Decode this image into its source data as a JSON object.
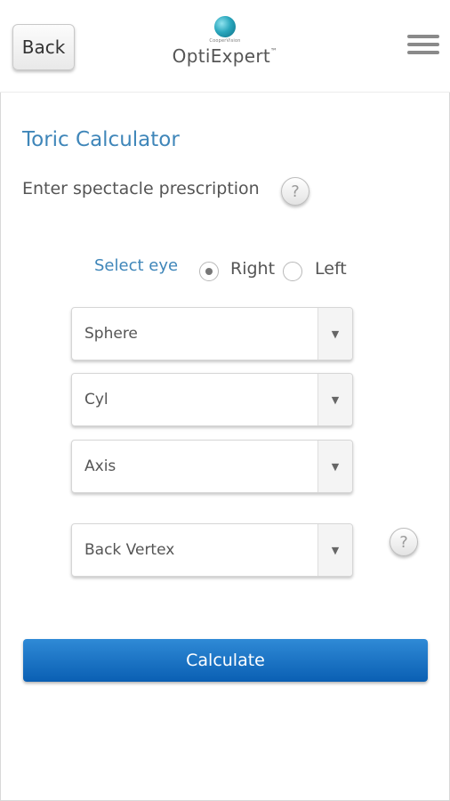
{
  "header": {
    "back_label": "Back",
    "logo_small": "CooperVision",
    "logo_name": "OptiExpert",
    "logo_tm": "™"
  },
  "main": {
    "title": "Toric Calculator",
    "subtitle": "Enter spectacle prescription",
    "help_glyph": "?",
    "select_eye_label": "Select eye",
    "eye_options": [
      {
        "label": "Right",
        "selected": true
      },
      {
        "label": "Left",
        "selected": false
      }
    ],
    "dropdowns": {
      "sphere": "Sphere",
      "cyl": "Cyl",
      "axis": "Axis",
      "back_vertex": "Back Vertex"
    },
    "dropdown_arrow": "▼",
    "calculate_label": "Calculate"
  },
  "colors": {
    "accent_text": "#3f86b9",
    "button_blue": "#1a73c4"
  },
  "icons": [
    "menu-icon",
    "help-icon",
    "chevron-down-icon",
    "logo-globe-icon"
  ]
}
